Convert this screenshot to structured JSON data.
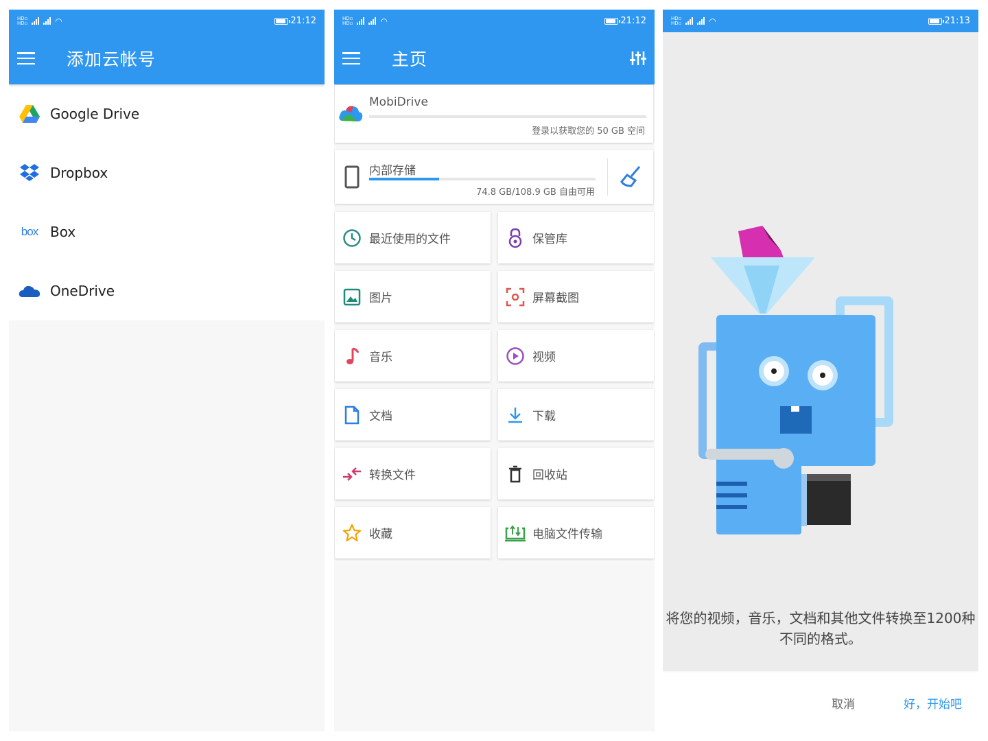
{
  "screen1": {
    "status": {
      "time": "21:12"
    },
    "title": "添加云帐号",
    "accounts": [
      {
        "label": "Google Drive",
        "icon": "google-drive-icon"
      },
      {
        "label": "Dropbox",
        "icon": "dropbox-icon"
      },
      {
        "label": "Box",
        "icon": "box-icon",
        "logo_text": "box"
      },
      {
        "label": "OneDrive",
        "icon": "onedrive-icon"
      }
    ]
  },
  "screen2": {
    "status": {
      "time": "21:12"
    },
    "title": "主页",
    "mobidrive": {
      "name": "MobiDrive",
      "subtitle": "登录以获取您的 50 GB 空间",
      "usage_fraction": 0.0
    },
    "internal": {
      "name": "内部存储",
      "subtitle": "74.8 GB/108.9 GB 自由可用",
      "usage_fraction": 0.31
    },
    "tiles": [
      {
        "label": "最近使用的文件",
        "icon": "clock-icon",
        "color": "#2a8a8a"
      },
      {
        "label": "保管库",
        "icon": "vault-lock-icon",
        "color": "#7b3fb0"
      },
      {
        "label": "图片",
        "icon": "image-icon",
        "color": "#1f8a7a"
      },
      {
        "label": "屏幕截图",
        "icon": "screenshot-icon",
        "color": "#e0574f"
      },
      {
        "label": "音乐",
        "icon": "music-note-icon",
        "color": "#e0475f"
      },
      {
        "label": "视频",
        "icon": "play-circle-icon",
        "color": "#9b4fc0"
      },
      {
        "label": "文档",
        "icon": "document-icon",
        "color": "#2f7fe0"
      },
      {
        "label": "下载",
        "icon": "download-icon",
        "color": "#2f97f0"
      },
      {
        "label": "转换文件",
        "icon": "convert-icon",
        "color": "#d03a6a"
      },
      {
        "label": "回收站",
        "icon": "trash-icon",
        "color": "#333333"
      },
      {
        "label": "收藏",
        "icon": "star-icon",
        "color": "#f2a500"
      },
      {
        "label": "电脑文件传输",
        "icon": "pc-transfer-icon",
        "color": "#3aa04a"
      }
    ]
  },
  "screen3": {
    "status": {
      "time": "21:13"
    },
    "intro_text": "将您的视频，音乐，文档和其他文件转换至1200种不同的格式。",
    "cancel_label": "取消",
    "ok_label": "好，开始吧"
  },
  "colors": {
    "primary": "#2f97f0",
    "background": "#f7f7f7"
  }
}
